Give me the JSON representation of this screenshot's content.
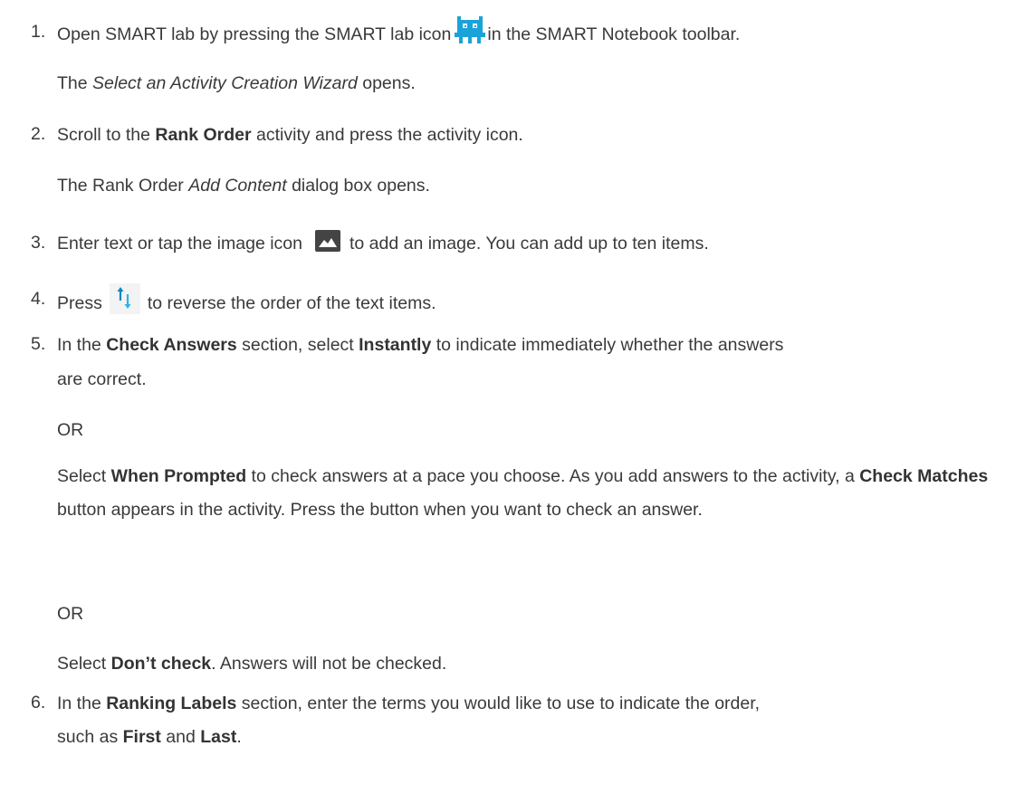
{
  "icons": {
    "smart_lab": "smart-lab-icon",
    "image": "image-icon",
    "reverse": "reverse-order-icon"
  },
  "colors": {
    "text": "#3a3a3a",
    "lab_icon": "#1aa3d9",
    "image_icon": "#444444",
    "reverse_up": "#0b86c4",
    "reverse_down": "#27b4ec"
  },
  "steps": [
    {
      "number": "1.",
      "text_before_icon": "Open SMART lab by pressing the SMART lab icon",
      "text_after_icon": "in the SMART Notebook toolbar.",
      "result_prefix": "The ",
      "result_italic": "Select an Activity Creation Wizard",
      "result_suffix": " opens."
    },
    {
      "number": "2.",
      "text_prefix": "Scroll to the ",
      "text_bold": "Rank Order",
      "text_suffix": " activity and press the activity icon.",
      "result_prefix": "The Rank Order ",
      "result_italic": "Add Content",
      "result_suffix": " dialog box opens."
    },
    {
      "number": "3.",
      "text_before_icon": "Enter text or tap the image icon",
      "text_after_icon": "to add an image. You can add up to ten items."
    },
    {
      "number": "4.",
      "text_before_icon": "Press",
      "text_after_icon": "to reverse the order of the text items."
    },
    {
      "number": "5.",
      "line1_prefix": "In the ",
      "line1_bold1": "Check Answers",
      "line1_mid": " section, select ",
      "line1_bold2": "Instantly",
      "line1_suffix": " to indicate immediately whether the answers",
      "line2": "are correct.",
      "or1": "OR",
      "p2_prefix": "Select ",
      "p2_bold1": "When Prompted",
      "p2_mid1": " to check answers at a pace you choose. As you add answers to the activity, a ",
      "p2_bold2": "Check Matches",
      "p2_suffix": " button appears in the activity. Press the button when you want to check an answer.",
      "or2": "OR",
      "p3_prefix": "Select ",
      "p3_bold": "Don’t check",
      "p3_suffix": ". Answers will not be checked."
    },
    {
      "number": "6.",
      "line1_prefix": "In the ",
      "line1_bold": "Ranking Labels",
      "line1_suffix": " section, enter the terms you would like to use to indicate the order,",
      "line2_prefix": "such as ",
      "line2_bold1": "First",
      "line2_mid": " and ",
      "line2_bold2": "Last",
      "line2_suffix": "."
    }
  ]
}
